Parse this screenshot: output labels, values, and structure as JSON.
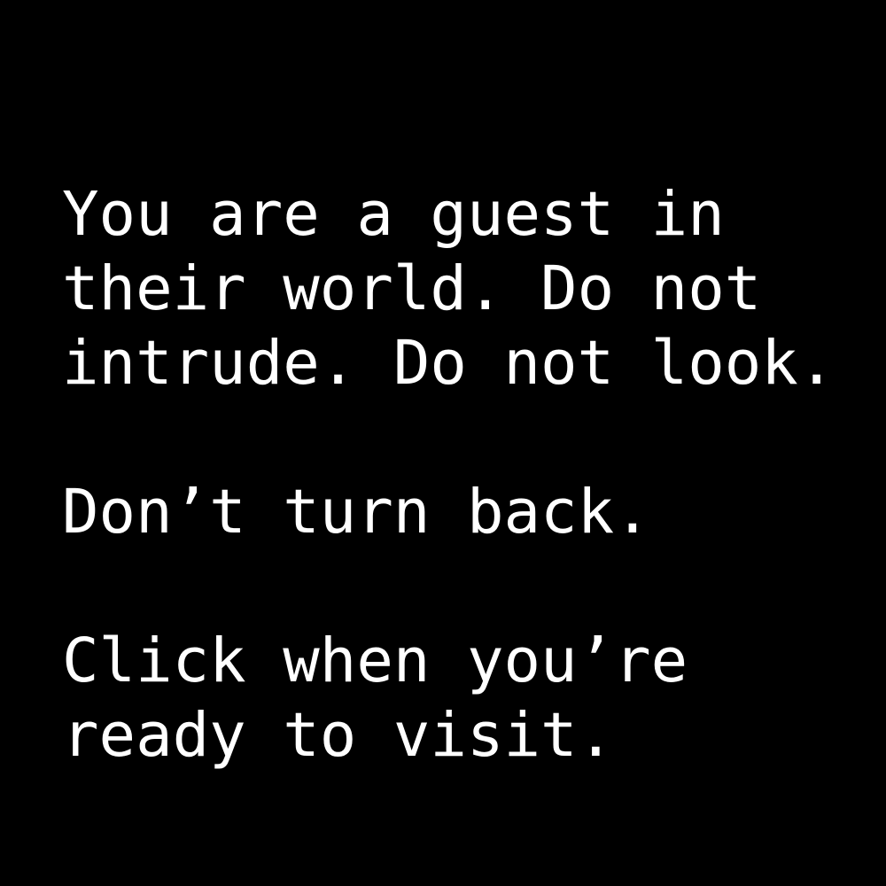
{
  "colors": {
    "background": "#000000",
    "text": "#ffffff"
  },
  "intro": {
    "lines": [
      "You are a guest in",
      "their world. Do not",
      "intrude. Do not look.",
      "",
      "Don’t turn back.",
      "",
      "Click when you’re",
      "ready to visit."
    ]
  }
}
